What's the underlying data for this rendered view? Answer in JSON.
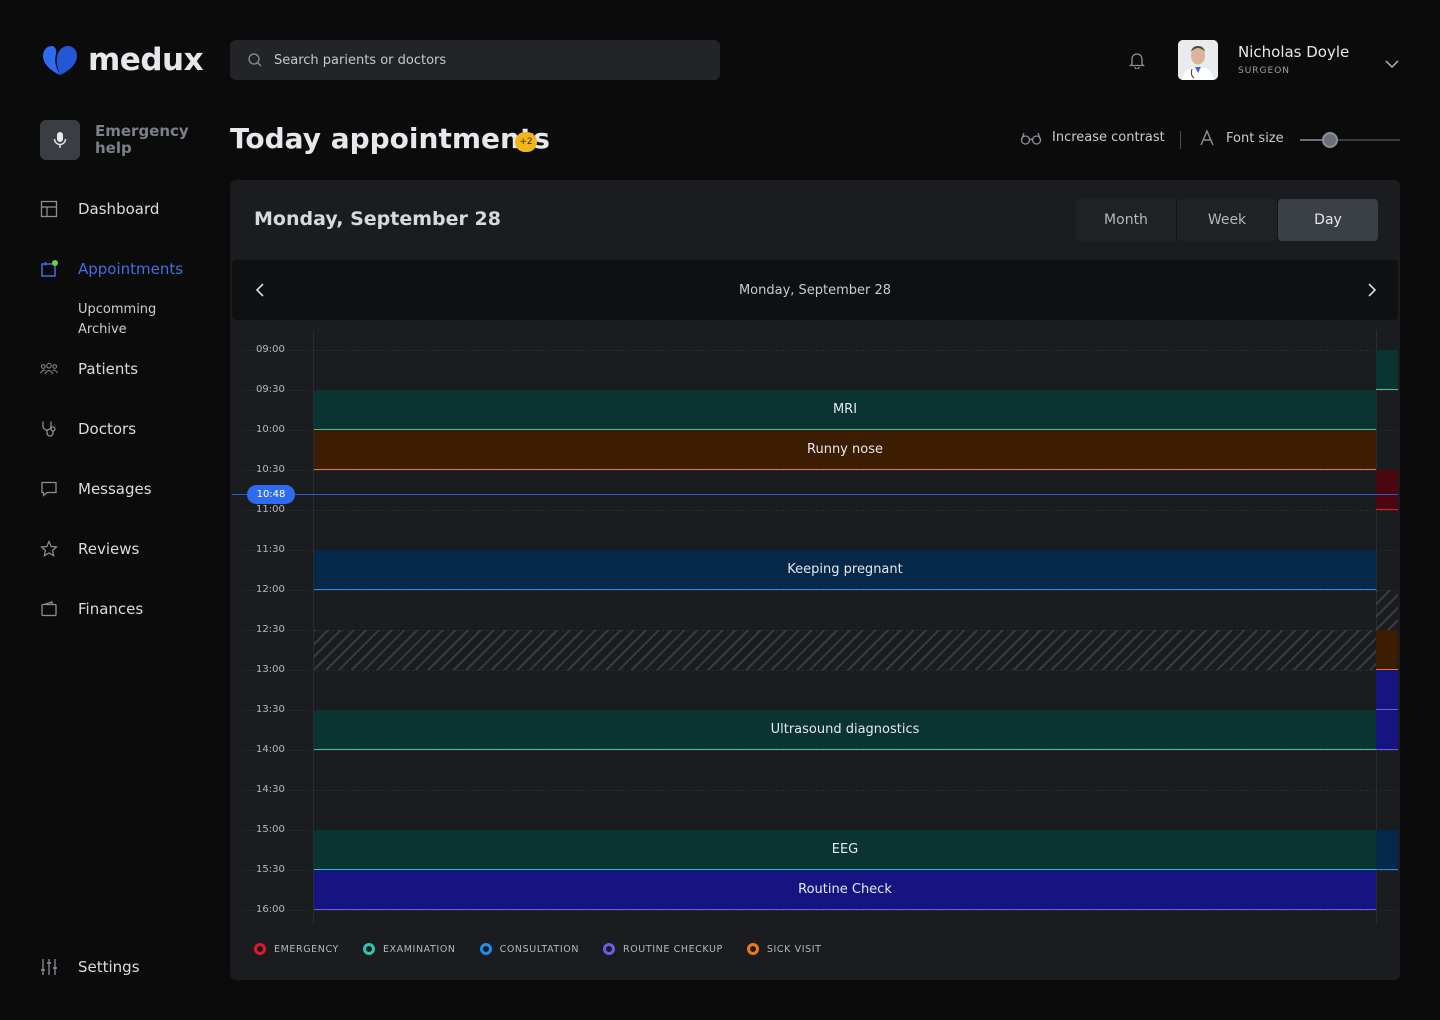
{
  "brand": {
    "name": "medux",
    "color": "#2f6bf0"
  },
  "search": {
    "placeholder": "Search parients or doctors"
  },
  "user": {
    "name": "Nicholas Doyle",
    "role": "SURGEON"
  },
  "sidebar": {
    "emergency_label": "Emergency help",
    "items": [
      {
        "label": "Dashboard",
        "icon": "grid-icon"
      },
      {
        "label": "Appointments",
        "icon": "calendar-icon",
        "active": true,
        "sub": [
          "Upcomming",
          "Archive"
        ]
      },
      {
        "label": "Patients",
        "icon": "people-icon"
      },
      {
        "label": "Doctors",
        "icon": "stethoscope-icon"
      },
      {
        "label": "Messages",
        "icon": "message-icon"
      },
      {
        "label": "Reviews",
        "icon": "star-icon"
      },
      {
        "label": "Finances",
        "icon": "wallet-icon"
      }
    ],
    "settings_label": "Settings"
  },
  "page": {
    "title": "Today appointments",
    "badge": "+2"
  },
  "accessibility": {
    "contrast_label": "Increase contrast",
    "font_label": "Font size",
    "font_level": 0.3
  },
  "calendar": {
    "heading": "Monday, September 28",
    "views": [
      "Month",
      "Week",
      "Day"
    ],
    "active_view": "Day",
    "day_label": "Monday, September 28",
    "now": "10:48",
    "times": [
      "09:00",
      "09:30",
      "10:00",
      "10:30",
      "11:00",
      "11:30",
      "12:00",
      "12:30",
      "13:00",
      "13:30",
      "14:00",
      "14:30",
      "15:00",
      "15:30",
      "16:00"
    ],
    "events": [
      {
        "title": "MRI",
        "start": "09:30",
        "end": "10:00",
        "type": "examination"
      },
      {
        "title": "Runny nose",
        "start": "10:00",
        "end": "10:30",
        "type": "sick"
      },
      {
        "title": "Keeping pregnant",
        "start": "11:30",
        "end": "12:00",
        "type": "consultation"
      },
      {
        "title": "",
        "start": "12:30",
        "end": "13:00",
        "type": "blocked"
      },
      {
        "title": "Ultrasound diagnostics",
        "start": "13:30",
        "end": "14:00",
        "type": "examination"
      },
      {
        "title": "EEG",
        "start": "15:00",
        "end": "15:30",
        "type": "examination"
      },
      {
        "title": "Routine Check",
        "start": "15:30",
        "end": "16:00",
        "type": "routine"
      }
    ]
  },
  "legend": [
    {
      "label": "EMERGENCY",
      "color": "#e0182a"
    },
    {
      "label": "EXAMINATION",
      "color": "#2ec4b0"
    },
    {
      "label": "CONSULTATION",
      "color": "#1e8fe8"
    },
    {
      "label": "ROUTINE CHECKUP",
      "color": "#6e5ce6"
    },
    {
      "label": "SICK VISIT",
      "color": "#ee7a16"
    }
  ]
}
